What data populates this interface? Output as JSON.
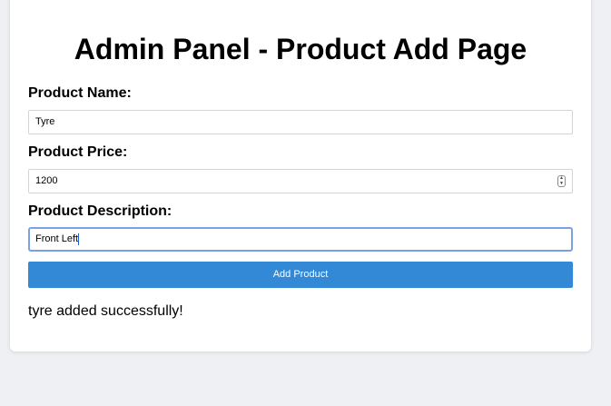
{
  "page": {
    "title": "Admin Panel - Product Add Page"
  },
  "form": {
    "name": {
      "label": "Product Name:",
      "value": "Tyre"
    },
    "price": {
      "label": "Product Price:",
      "value": "1200"
    },
    "description": {
      "label": "Product Description:",
      "value": "Front Left"
    },
    "submit_label": "Add Product"
  },
  "status": {
    "message": "tyre added successfully!"
  },
  "colors": {
    "accent": "#3389d6",
    "focus_ring": "#7aa0e6",
    "background": "#eef0f3"
  },
  "icons": {
    "stepper": "up-down-stepper-icon"
  }
}
